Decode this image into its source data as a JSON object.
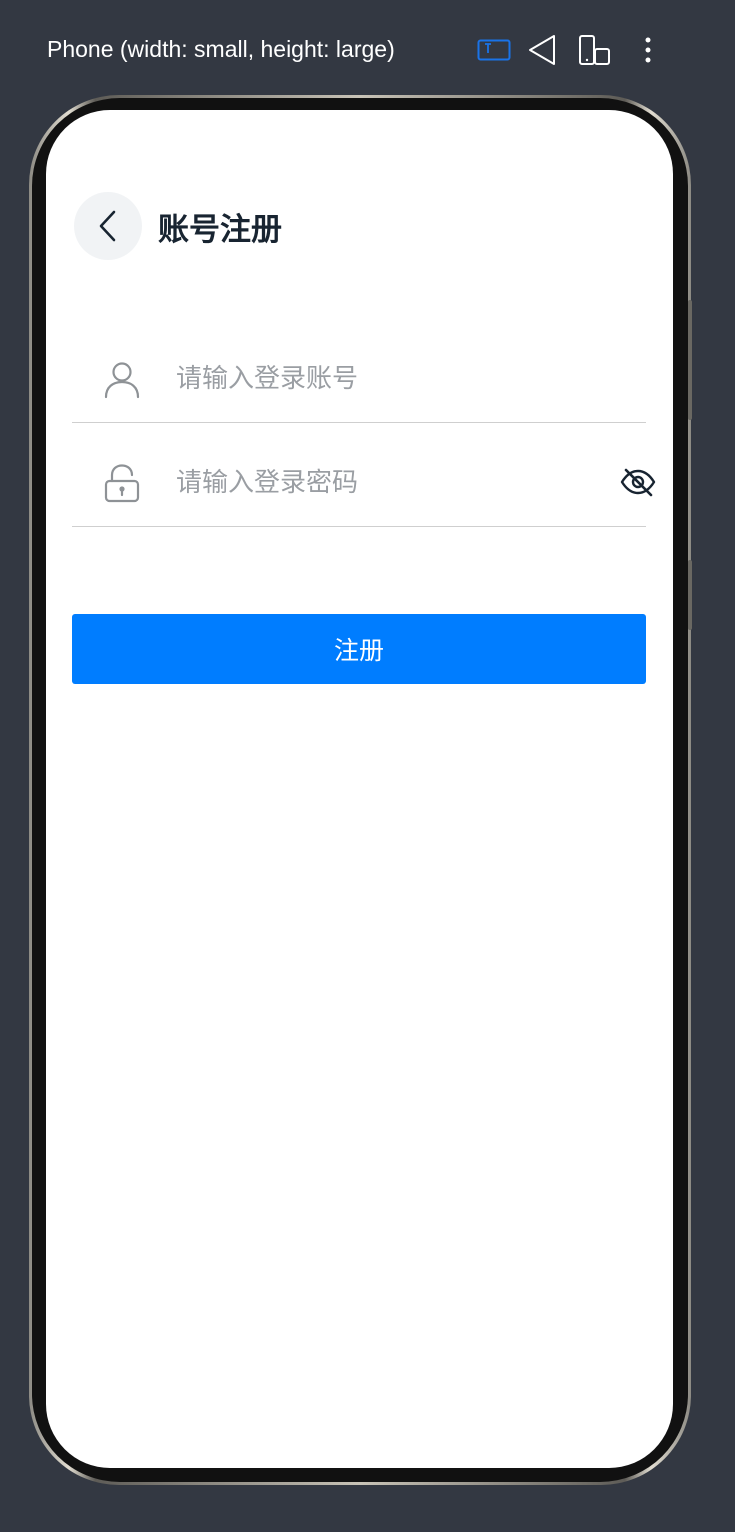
{
  "toolbar": {
    "device_label": "Phone (width: small, height: large)",
    "icons": [
      "ruler-icon",
      "rotate-icon",
      "fold-device-icon",
      "more-vertical-icon"
    ],
    "accent_color": "#1a73e8"
  },
  "page": {
    "title": "账号注册",
    "account": {
      "placeholder": "请输入登录账号",
      "value": ""
    },
    "password": {
      "placeholder": "请输入登录密码",
      "value": ""
    },
    "register_label": "注册",
    "colors": {
      "primary": "#007dff",
      "title": "#182431",
      "placeholder": "#9a9ea3",
      "back_bg": "#f1f3f5"
    }
  }
}
